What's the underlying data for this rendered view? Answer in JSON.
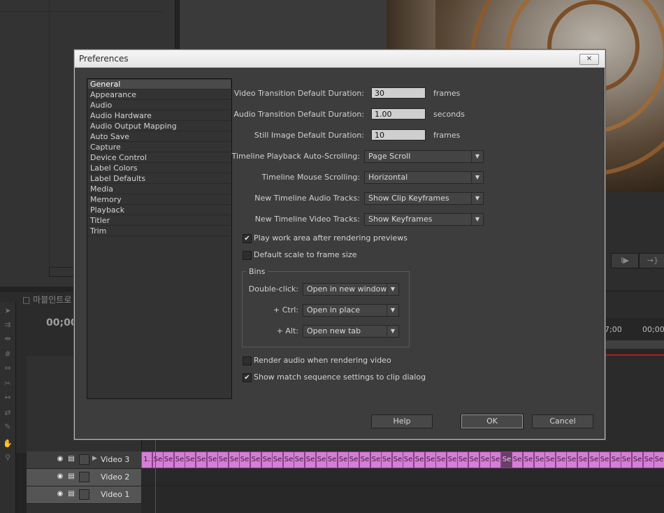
{
  "background": {
    "timeline_tab": "□ 마블인트로",
    "timecode": "00;00",
    "ruler_left": "7;00",
    "ruler_right": "00;00;",
    "tracks": [
      {
        "name": "Video 3",
        "selected": false
      },
      {
        "name": "Video 2",
        "selected": true
      },
      {
        "name": "Video 1",
        "selected": true
      }
    ],
    "clip_first": "1.",
    "clip_label": "Se",
    "controls": {
      "step": "I▶",
      "out": "→}"
    }
  },
  "dialog": {
    "title": "Preferences",
    "close_label": "✕",
    "categories": [
      "General",
      "Appearance",
      "Audio",
      "Audio Hardware",
      "Audio Output Mapping",
      "Auto Save",
      "Capture",
      "Device Control",
      "Label Colors",
      "Label Defaults",
      "Media",
      "Memory",
      "Playback",
      "Titler",
      "Trim"
    ],
    "selected_category": "General",
    "fields": [
      {
        "label": "Video Transition Default Duration:",
        "value": "30",
        "unit": "frames"
      },
      {
        "label": "Audio Transition Default Duration:",
        "value": "1.00",
        "unit": "seconds"
      },
      {
        "label": "Still Image Default Duration:",
        "value": "10",
        "unit": "frames"
      }
    ],
    "dropdowns": [
      {
        "label": "Timeline Playback Auto-Scrolling:",
        "value": "Page Scroll"
      },
      {
        "label": "Timeline Mouse Scrolling:",
        "value": "Horizontal"
      },
      {
        "label": "New Timeline Audio Tracks:",
        "value": "Show Clip Keyframes"
      },
      {
        "label": "New Timeline Video Tracks:",
        "value": "Show Keyframes"
      }
    ],
    "checkbox_play_work_area": {
      "label": "Play work area after rendering previews",
      "checked": true
    },
    "checkbox_default_scale": {
      "label": "Default scale to frame size",
      "checked": false
    },
    "bins": {
      "title": "Bins",
      "rows": [
        {
          "label": "Double-click:",
          "value": "Open in new window"
        },
        {
          "label": "+ Ctrl:",
          "value": "Open in place"
        },
        {
          "label": "+ Alt:",
          "value": "Open new tab"
        }
      ]
    },
    "checkbox_render_audio": {
      "label": "Render audio when rendering video",
      "checked": false
    },
    "checkbox_match_sequence": {
      "label": "Show match sequence settings to clip dialog",
      "checked": true
    },
    "buttons": {
      "help": "Help",
      "ok": "OK",
      "cancel": "Cancel"
    },
    "check_mark": "✔"
  }
}
